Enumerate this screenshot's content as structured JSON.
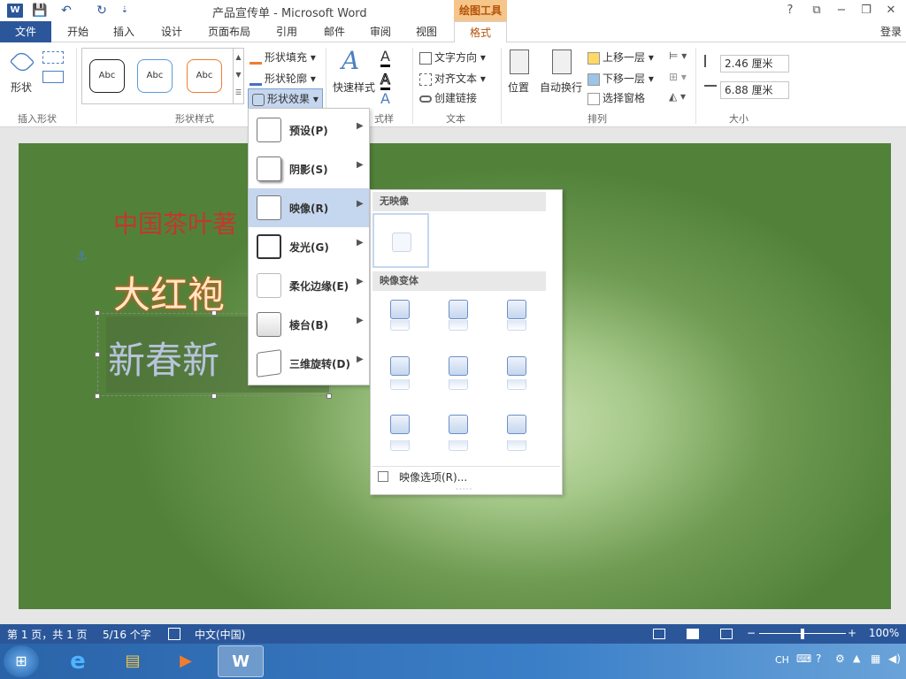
{
  "title_bar": {
    "app_title": "产品宣传单 - Microsoft Word",
    "context_tool": "绘图工具",
    "help": "?",
    "restore": "⧉",
    "minimize": "−",
    "maximize": "❐",
    "close": "✕",
    "qat": {
      "word": "W",
      "save": "💾",
      "undo": "↶",
      "redo": "↻",
      "customize": "⇣"
    }
  },
  "tabs": [
    {
      "label": "文件"
    },
    {
      "label": "开始"
    },
    {
      "label": "插入"
    },
    {
      "label": "设计"
    },
    {
      "label": "页面布局"
    },
    {
      "label": "引用"
    },
    {
      "label": "邮件"
    },
    {
      "label": "审阅"
    },
    {
      "label": "视图"
    },
    {
      "label": "格式"
    }
  ],
  "signin": "登录",
  "ribbon": {
    "insert_shapes": {
      "shapes_label": "形状",
      "group_label": "插入形状"
    },
    "shape_styles": {
      "samples": [
        "Abc",
        "Abc",
        "Abc"
      ],
      "fill": "形状填充",
      "outline": "形状轮廓",
      "effects": "形状效果",
      "group_label": "形状样式"
    },
    "wordart": {
      "quick_styles": "快速样式",
      "group_label_partial": "式样"
    },
    "text": {
      "direction": "文字方向",
      "align": "对齐文本",
      "link": "创建链接",
      "group_label": "文本"
    },
    "arrange": {
      "position": "位置",
      "wrap": "自动换行",
      "forward": "上移一层",
      "backward": "下移一层",
      "selection_pane": "选择窗格",
      "group_label": "排列"
    },
    "size": {
      "height": "2.46 厘米",
      "width": "6.88 厘米",
      "group_label": "大小"
    }
  },
  "document": {
    "line1": "中国茶叶著",
    "line2": "大红袍",
    "line3": "新春新"
  },
  "effects_menu": {
    "items": [
      {
        "label": "预设(P)"
      },
      {
        "label": "阴影(S)"
      },
      {
        "label": "映像(R)"
      },
      {
        "label": "发光(G)"
      },
      {
        "label": "柔化边缘(E)"
      },
      {
        "label": "棱台(B)"
      },
      {
        "label": "三维旋转(D)"
      }
    ],
    "highlighted": "映像(R)"
  },
  "reflection_menu": {
    "no_reflection": "无映像",
    "variants": "映像变体",
    "options": "映像选项(R)..."
  },
  "status_bar": {
    "page": "第 1 页，共 1 页",
    "words": "5/16 个字",
    "language": "中文(中国)",
    "zoom": "100%",
    "zoom_level": 1.0
  },
  "taskbar": {
    "ime": "CH"
  }
}
